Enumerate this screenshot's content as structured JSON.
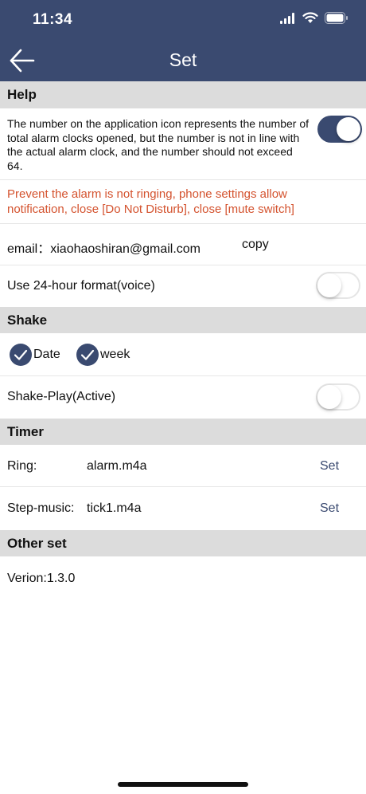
{
  "status_bar": {
    "time": "11:34"
  },
  "nav": {
    "title": "Set",
    "back_icon": "arrow-left-icon"
  },
  "sections": {
    "help": "Help",
    "shake": "Shake",
    "timer": "Timer",
    "other": "Other set"
  },
  "help": {
    "badge_text": "The number on the application icon represents the number of total alarm clocks opened, but the number is not in line with the actual alarm clock, and the number should not exceed 64.",
    "badge_toggle_on": true,
    "warning": "Prevent the alarm is not ringing, phone settings allow notification, close [Do Not Disturb], close [mute switch]",
    "email_label": "email：xiaohaoshiran@gmail.com",
    "copy_label": "copy",
    "format_label": "Use 24-hour format(voice)",
    "format_toggle_on": false
  },
  "shake": {
    "date_label": "Date",
    "week_label": "week",
    "shake_play_label": "Shake-Play(Active)",
    "shake_play_on": false
  },
  "timer": {
    "ring_label": "Ring:",
    "ring_value": "alarm.m4a",
    "ring_set": "Set",
    "step_label": "Step-music:",
    "step_value": "tick1.m4a",
    "step_set": "Set"
  },
  "other": {
    "version": "Verion:1.3.0"
  },
  "colors": {
    "accent": "#3a4a70",
    "warning": "#d4532f",
    "section_bg": "#dcdcdc"
  }
}
